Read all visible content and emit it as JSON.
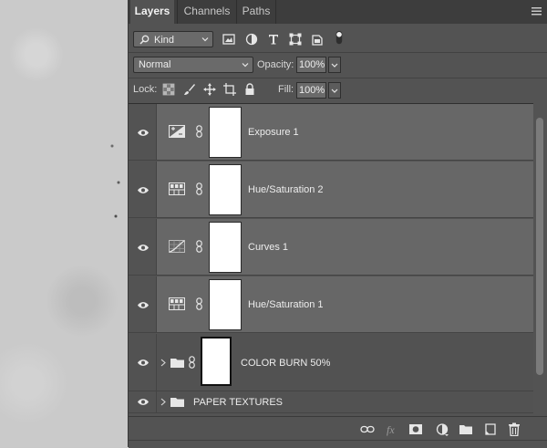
{
  "tabs": [
    {
      "label": "Layers",
      "active": true
    },
    {
      "label": "Channels",
      "active": false
    },
    {
      "label": "Paths",
      "active": false
    }
  ],
  "filter": {
    "kind_label": "Kind",
    "icons": [
      "pixel-filter-icon",
      "adjustment-filter-icon",
      "type-filter-icon",
      "shape-filter-icon",
      "smart-object-filter-icon",
      "filter-toggle-icon"
    ]
  },
  "blend": {
    "mode": "Normal",
    "opacity_label": "Opacity:",
    "opacity_value": "100%"
  },
  "lock": {
    "label": "Lock:",
    "fill_label": "Fill:",
    "fill_value": "100%"
  },
  "layers": [
    {
      "name": "Exposure 1",
      "type": "exposure"
    },
    {
      "name": "Hue/Saturation 2",
      "type": "hue-saturation"
    },
    {
      "name": "Curves 1",
      "type": "curves"
    },
    {
      "name": "Hue/Saturation 1",
      "type": "hue-saturation"
    }
  ],
  "groups": [
    {
      "name": "COLOR BURN 50%",
      "has_mask": true
    },
    {
      "name": "PAPER TEXTURES",
      "has_mask": false
    }
  ],
  "bottom_icons": [
    "link-layers-icon",
    "fx-icon",
    "add-mask-icon",
    "new-adjustment-icon",
    "new-group-icon",
    "new-layer-icon",
    "delete-icon"
  ],
  "colors": {
    "panel": "#535353",
    "selected_row": "#676767",
    "tabbar": "#3d3d3d"
  }
}
